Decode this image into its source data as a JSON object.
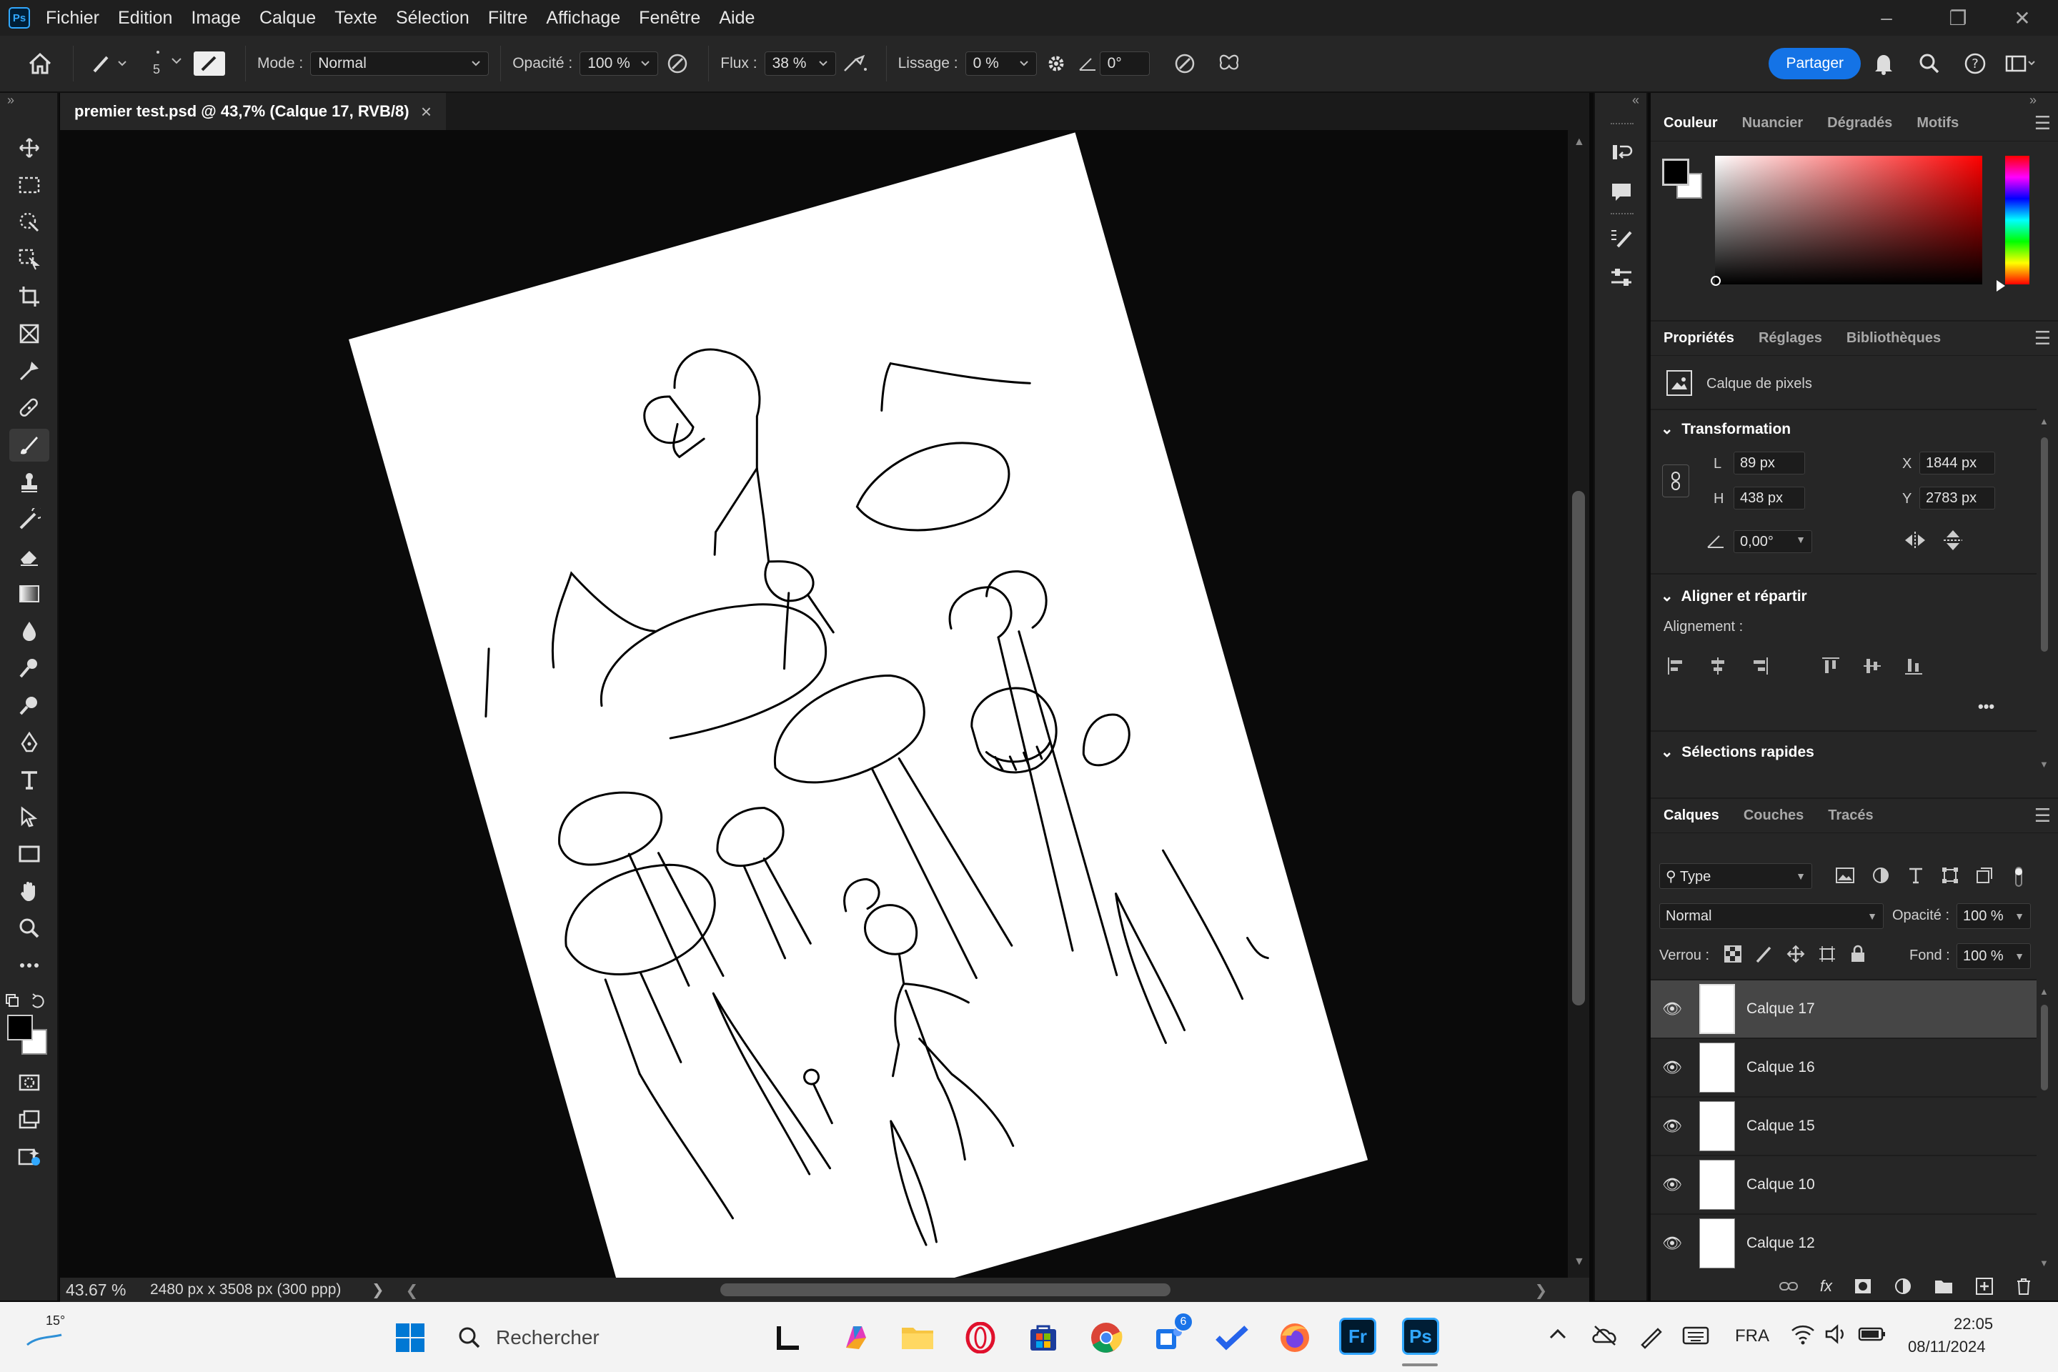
{
  "menubar": {
    "app_icon": "Ps",
    "items": [
      "Fichier",
      "Edition",
      "Image",
      "Calque",
      "Texte",
      "Sélection",
      "Filtre",
      "Affichage",
      "Fenêtre",
      "Aide"
    ]
  },
  "options": {
    "brush_size": "5",
    "mode_label": "Mode :",
    "mode_value": "Normal",
    "opacity_label": "Opacité :",
    "opacity_value": "100 %",
    "flow_label": "Flux :",
    "flow_value": "38 %",
    "smoothing_label": "Lissage :",
    "smoothing_value": "0 %",
    "angle_value": "0°",
    "share_label": "Partager"
  },
  "document": {
    "tab_title": "premier test.psd @ 43,7% (Calque 17, RVB/8)",
    "close_glyph": "×",
    "zoom": "43.67 %",
    "dimensions": "2480 px x 3508 px (300 ppp)"
  },
  "color_panel": {
    "tabs": [
      "Couleur",
      "Nuancier",
      "Dégradés",
      "Motifs"
    ],
    "foreground": "#000000",
    "background": "#ffffff"
  },
  "properties_panel": {
    "tabs": [
      "Propriétés",
      "Réglages",
      "Bibliothèques"
    ],
    "layer_kind": "Calque de pixels",
    "transform_title": "Transformation",
    "L_label": "L",
    "L_value": "89 px",
    "H_label": "H",
    "H_value": "438 px",
    "X_label": "X",
    "X_value": "1844 px",
    "Y_label": "Y",
    "Y_value": "2783 px",
    "angle_value": "0,00°",
    "align_title": "Aligner et répartir",
    "alignment_label": "Alignement :",
    "quick_sel_title": "Sélections rapides",
    "more_glyph": "•••"
  },
  "layers_panel": {
    "tabs": [
      "Calques",
      "Couches",
      "Tracés"
    ],
    "filter_value": "Type",
    "blend_value": "Normal",
    "opacity_label": "Opacité :",
    "opacity_value": "100 %",
    "lock_label": "Verrou :",
    "fill_label": "Fond :",
    "fill_value": "100 %",
    "fx_label": "fx",
    "layers": [
      {
        "name": "Calque 17",
        "selected": true
      },
      {
        "name": "Calque 16",
        "selected": false
      },
      {
        "name": "Calque 15",
        "selected": false
      },
      {
        "name": "Calque 10",
        "selected": false
      },
      {
        "name": "Calque 12",
        "selected": false
      }
    ]
  },
  "taskbar": {
    "weather": "15°",
    "search_placeholder": "Rechercher",
    "teams_badge": "6",
    "fr_label": "Fr",
    "ps_label": "Ps",
    "language": "FRA",
    "time": "22:05",
    "date": "08/11/2024"
  },
  "colors": {
    "accent": "#1473e6",
    "ps_blue": "#31a8ff"
  }
}
